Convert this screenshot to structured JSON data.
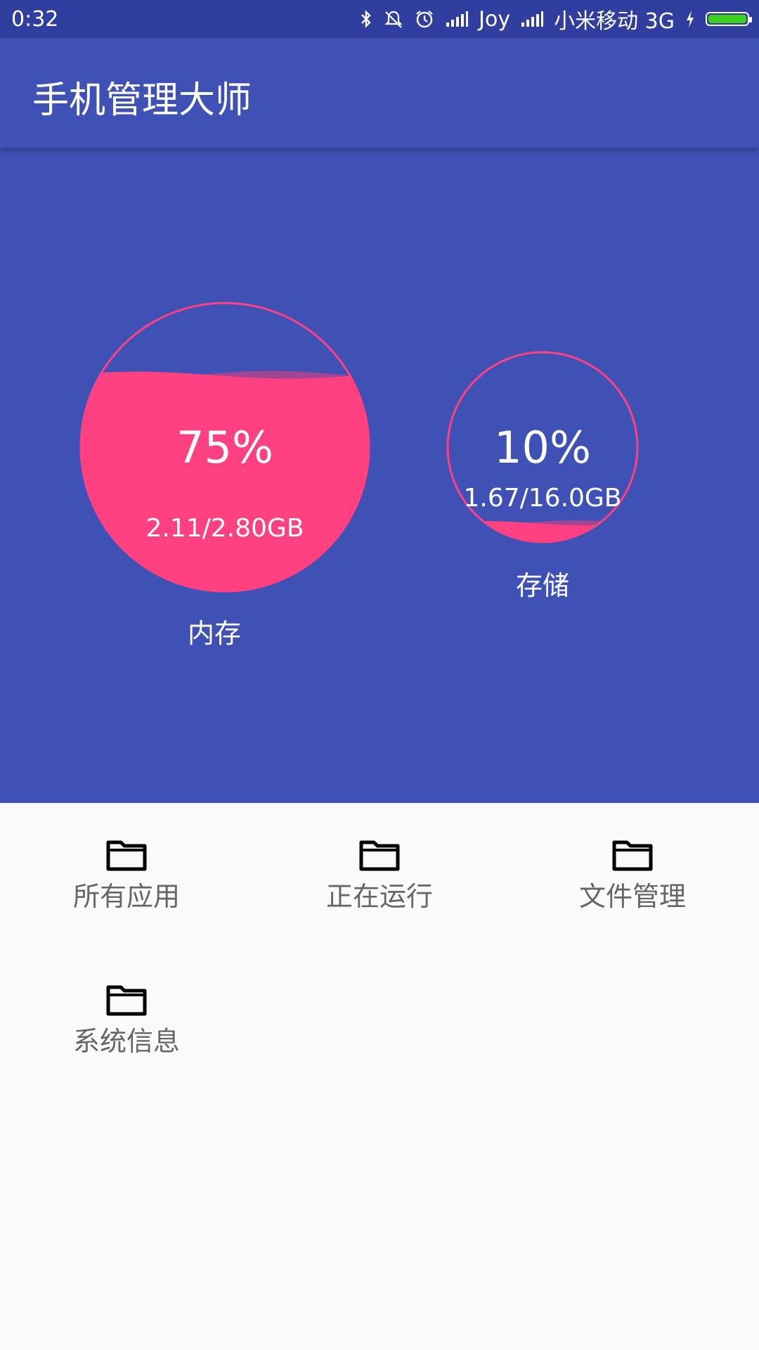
{
  "status_bar": {
    "time": "0:32",
    "carrier1": "Joy",
    "carrier2": "小米移动 3G",
    "battery_level": 1.0,
    "icons": [
      "bluetooth-icon",
      "vibrate-off-icon",
      "alarm-icon",
      "signal-icon",
      "signal-icon",
      "charging-icon",
      "battery-icon"
    ]
  },
  "app_bar": {
    "title": "手机管理大师"
  },
  "memory": {
    "percent_text": "75%",
    "usage_text": "2.11/2.80GB",
    "label": "内存",
    "fill_fraction": 0.75
  },
  "storage": {
    "percent_text": "10%",
    "usage_text": "1.67/16.0GB",
    "label": "存储",
    "fill_fraction": 0.1
  },
  "colors": {
    "primary": "#3F51B5",
    "primary_dark": "#303F9F",
    "accent": "#FF4081",
    "background": "#FAFAFA",
    "battery": "#3DD11F"
  },
  "grid": {
    "items": [
      {
        "label": "所有应用",
        "icon": "folder-icon"
      },
      {
        "label": "正在运行",
        "icon": "folder-icon"
      },
      {
        "label": "文件管理",
        "icon": "folder-icon"
      },
      {
        "label": "系统信息",
        "icon": "folder-icon"
      }
    ]
  }
}
